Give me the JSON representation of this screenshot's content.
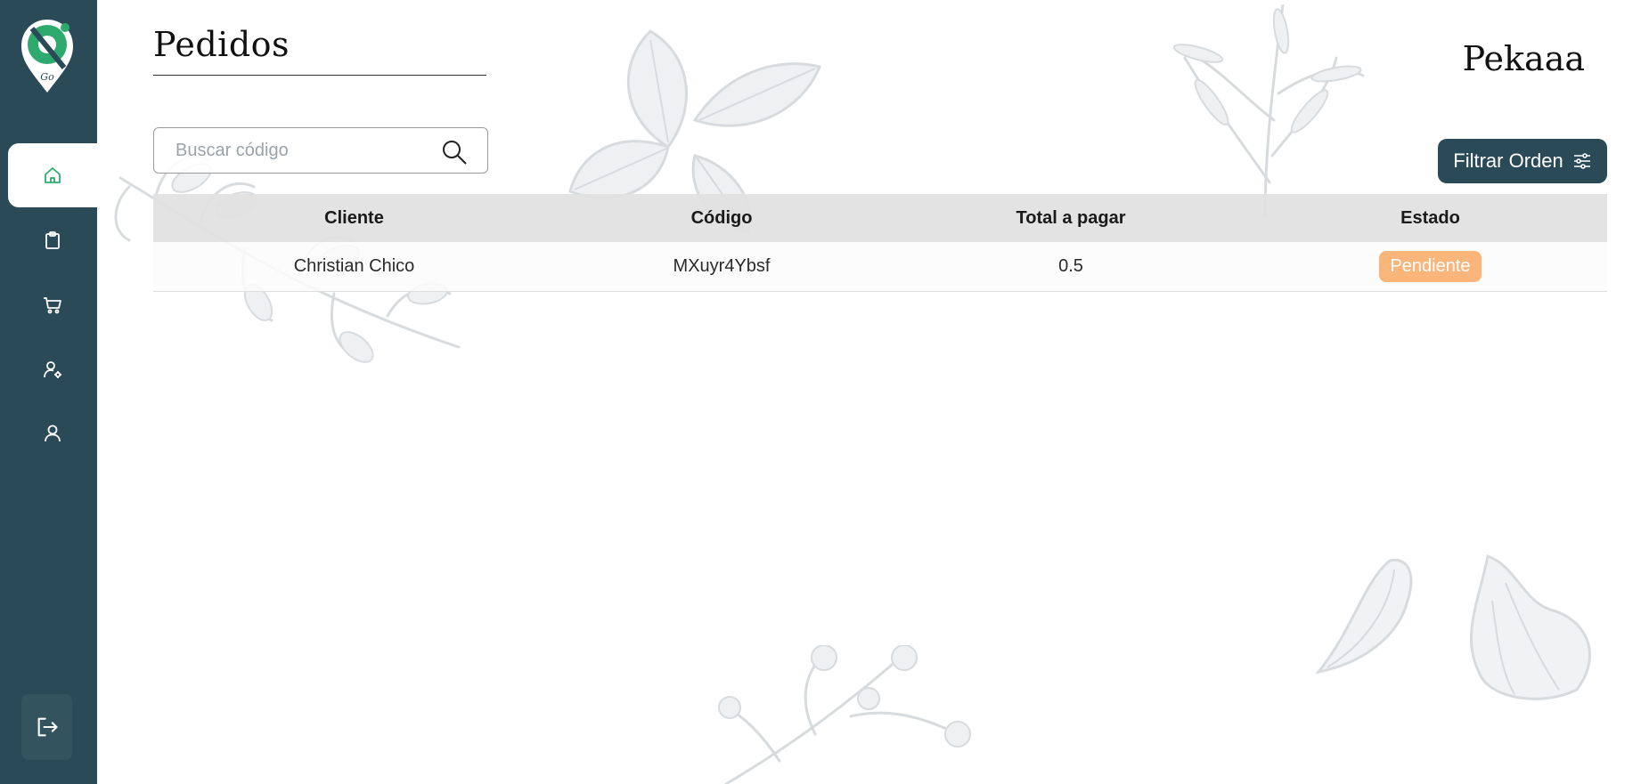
{
  "sidebar": {
    "items": [
      {
        "name": "home",
        "icon": "home-icon"
      },
      {
        "name": "orders",
        "icon": "clipboard-icon"
      },
      {
        "name": "cart",
        "icon": "cart-icon"
      },
      {
        "name": "user-settings",
        "icon": "user-gear-icon"
      },
      {
        "name": "profile",
        "icon": "user-icon"
      }
    ],
    "logout_icon": "logout-icon",
    "logo_text": "Go"
  },
  "header": {
    "title": "Pedidos",
    "username": "Pekaaa"
  },
  "search": {
    "placeholder": "Buscar código",
    "value": ""
  },
  "filter": {
    "label": "Filtrar Orden"
  },
  "table": {
    "columns": [
      "Cliente",
      "Código",
      "Total a pagar",
      "Estado"
    ],
    "rows": [
      {
        "cliente": "Christian Chico",
        "codigo": "MXuyr4Ybsf",
        "total": "0.5",
        "estado": "Pendiente"
      }
    ]
  },
  "colors": {
    "sidebar": "#2a4a58",
    "accent": "#2eaa6e",
    "status_pending": "#f9b57a"
  }
}
